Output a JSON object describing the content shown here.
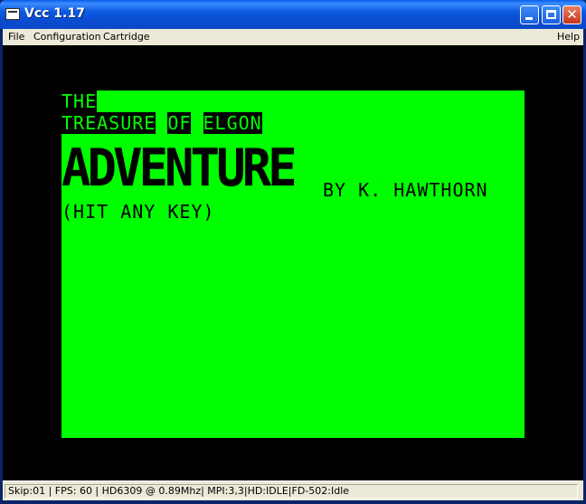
{
  "window": {
    "title": "Vcc 1.17"
  },
  "menu": {
    "file": "File",
    "configuration": "Configuration",
    "cartridge": "Cartridge",
    "help": "Help"
  },
  "screen": {
    "line1": "THE",
    "line2_words": [
      "TREASURE",
      "OF",
      "ELGON"
    ],
    "big_title": "ADVENTURE",
    "byline": "BY K. HAWTHORN",
    "prompt": "(HIT ANY KEY)"
  },
  "status": {
    "text": "Skip:01 | FPS: 60 | HD6309 @ 0.89Mhz| MPI:3,3|HD:IDLE|FD-502:Idle"
  },
  "colors": {
    "screen_green": "#00FF00",
    "border": "#000000",
    "titlebar": "#0A5CEB"
  },
  "icons": [
    "app-icon",
    "minimize-icon",
    "maximize-icon",
    "close-icon"
  ]
}
